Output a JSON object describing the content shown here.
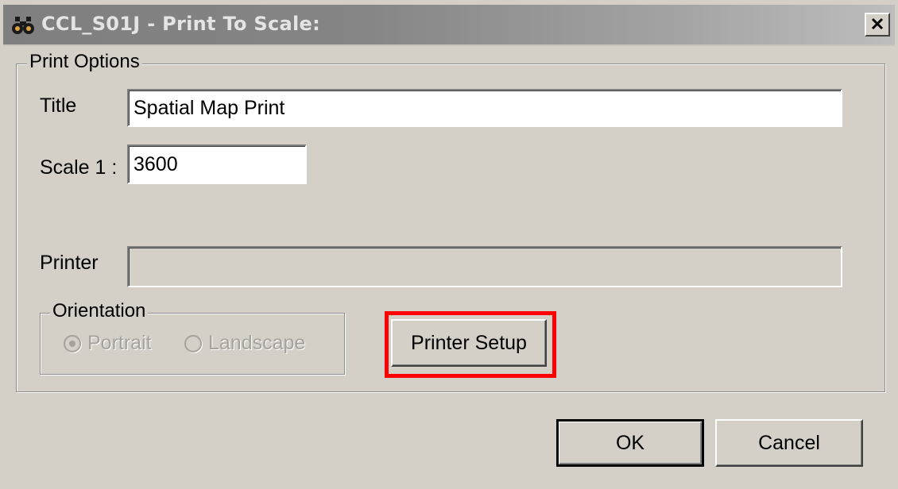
{
  "window": {
    "title": "CCL_S01J - Print To Scale:",
    "icon": "binoculars-icon",
    "close_label": "close"
  },
  "print_options": {
    "legend": "Print Options",
    "title_label": "Title",
    "title_value": "Spatial Map Print",
    "scale_label": "Scale 1 :",
    "scale_value": "3600",
    "printer_label": "Printer",
    "printer_value": ""
  },
  "orientation": {
    "legend": "Orientation",
    "portrait_label": "Portrait",
    "landscape_label": "Landscape",
    "selected": "Portrait",
    "enabled": false
  },
  "buttons": {
    "printer_setup": "Printer Setup",
    "ok": "OK",
    "cancel": "Cancel"
  },
  "highlight": {
    "target": "printer-setup-button",
    "color": "#ff0000"
  }
}
